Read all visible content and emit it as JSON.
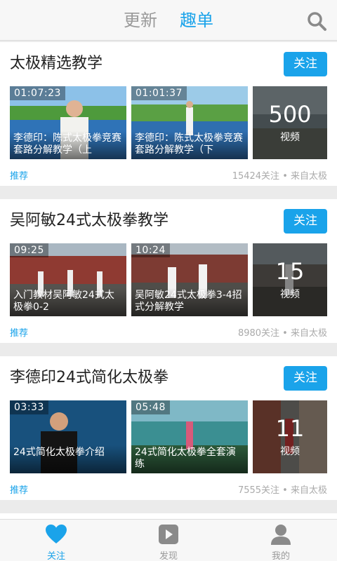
{
  "header": {
    "tabs": [
      {
        "label": "更新",
        "active": false
      },
      {
        "label": "趣单",
        "active": true
      }
    ],
    "search_icon": "search-icon"
  },
  "colors": {
    "accent": "#1aa3ea",
    "muted": "#9a9a9a"
  },
  "cards": [
    {
      "title": "太极精选教学",
      "follow_label": "关注",
      "videos": [
        {
          "duration": "01:07:23",
          "caption": "李德印：陈式太极拳竞赛套路分解教学（上"
        },
        {
          "duration": "01:01:37",
          "caption": "李德印：陈式太极拳竞赛套路分解教学（下"
        }
      ],
      "more": {
        "count": "500",
        "unit": "视频"
      },
      "tag": "推荐",
      "meta": "15424关注 • 来自太极"
    },
    {
      "title": "吴阿敏24式太极拳教学",
      "follow_label": "关注",
      "videos": [
        {
          "duration": "09:25",
          "caption": "入门教材吴阿敏24式太极拳0-2"
        },
        {
          "duration": "10:24",
          "caption": "吴阿敏24式太极拳3-4招式分解教学"
        }
      ],
      "more": {
        "count": "15",
        "unit": "视频"
      },
      "tag": "推荐",
      "meta": "8980关注 • 来自太极"
    },
    {
      "title": "李德印24式简化太极拳",
      "follow_label": "关注",
      "videos": [
        {
          "duration": "03:33",
          "caption": "24式简化太极拳介绍"
        },
        {
          "duration": "05:48",
          "caption": "24式简化太极拳全套演练"
        }
      ],
      "more": {
        "count": "11",
        "unit": "视频"
      },
      "tag": "推荐",
      "meta": "7555关注 • 来自太极"
    }
  ],
  "tabbar": [
    {
      "label": "关注",
      "icon": "heart-icon",
      "active": true
    },
    {
      "label": "发现",
      "icon": "play-icon",
      "active": false
    },
    {
      "label": "我的",
      "icon": "user-icon",
      "active": false
    }
  ]
}
